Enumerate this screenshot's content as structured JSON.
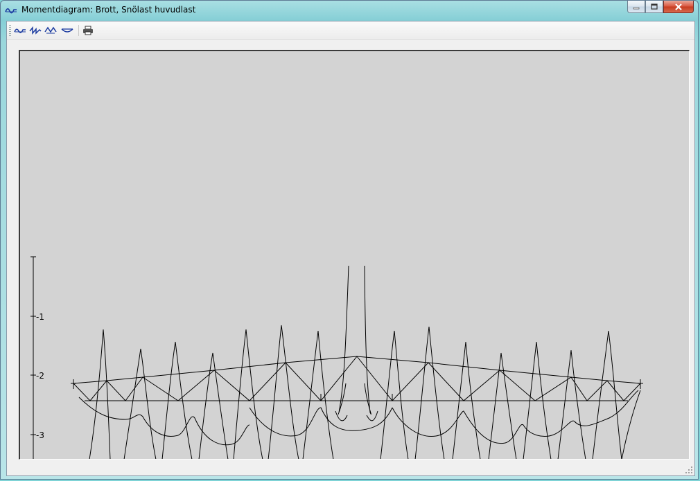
{
  "window": {
    "title": "Momentdiagram: Brott, Snölast huvudlast",
    "icon": "moment-diagram-icon"
  },
  "toolbar": {
    "buttons": [
      {
        "name": "moment-diagram-icon"
      },
      {
        "name": "shear-diagram-icon"
      },
      {
        "name": "normal-force-diagram-icon"
      },
      {
        "name": "deflection-diagram-icon"
      },
      {
        "name": "print-icon"
      }
    ]
  },
  "scale": {
    "ticks": [
      "-1",
      "-2",
      "-3"
    ]
  },
  "colors": {
    "canvas_bg": "#d3d3d3",
    "lines": "#000000"
  }
}
